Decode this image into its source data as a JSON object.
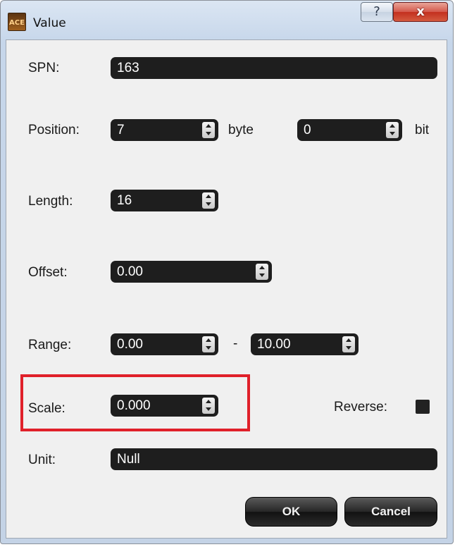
{
  "window": {
    "title": "Value",
    "app_icon_text": "ACE",
    "help_glyph": "?",
    "close_glyph": "x"
  },
  "form": {
    "spn": {
      "label": "SPN:",
      "value": "163"
    },
    "position": {
      "label": "Position:",
      "byte_value": "7",
      "byte_unit": "byte",
      "bit_value": "0",
      "bit_unit": "bit"
    },
    "length": {
      "label": "Length:",
      "value": "16"
    },
    "offset": {
      "label": "Offset:",
      "value": "0.00"
    },
    "range": {
      "label": "Range:",
      "min": "0.00",
      "separator": "-",
      "max": "10.00"
    },
    "scale": {
      "label": "Scale:",
      "value": "0.000"
    },
    "reverse": {
      "label": "Reverse:",
      "checked": true
    },
    "unit": {
      "label": "Unit:",
      "value": "Null"
    }
  },
  "buttons": {
    "ok": "OK",
    "cancel": "Cancel"
  },
  "colors": {
    "field_bg": "#1e1e1e",
    "highlight_border": "#e0202a",
    "client_bg": "#f0f0f0"
  },
  "icons": [
    "app-icon",
    "help-icon",
    "close-icon",
    "spin-up-icon",
    "spin-down-icon"
  ]
}
